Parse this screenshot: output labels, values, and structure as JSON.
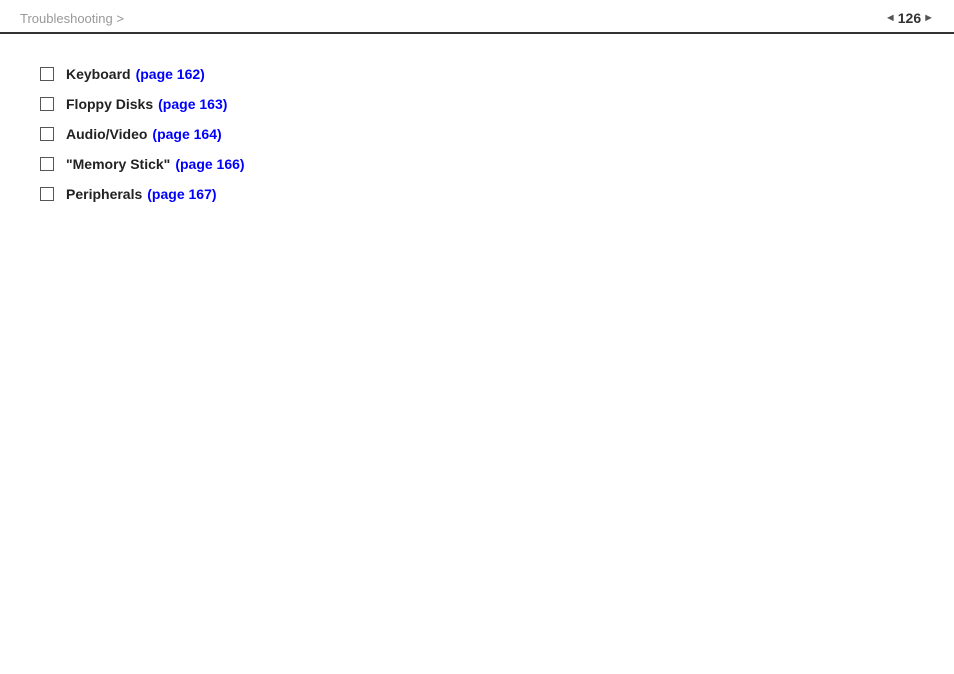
{
  "header": {
    "breadcrumb": "Troubleshooting >",
    "page_number": "126"
  },
  "content": {
    "items": [
      {
        "label": "Keyboard",
        "link_text": "(page 162)",
        "link_href": "#page162"
      },
      {
        "label": "Floppy Disks",
        "link_text": "(page 163)",
        "link_href": "#page163"
      },
      {
        "label": "Audio/Video",
        "link_text": "(page 164)",
        "link_href": "#page164"
      },
      {
        "label": "\"Memory Stick\"",
        "link_text": "(page 166)",
        "link_href": "#page166"
      },
      {
        "label": "Peripherals",
        "link_text": "(page 167)",
        "link_href": "#page167"
      }
    ]
  },
  "colors": {
    "link": "#0000ff",
    "label": "#222222",
    "breadcrumb": "#999999",
    "border": "#333333"
  }
}
